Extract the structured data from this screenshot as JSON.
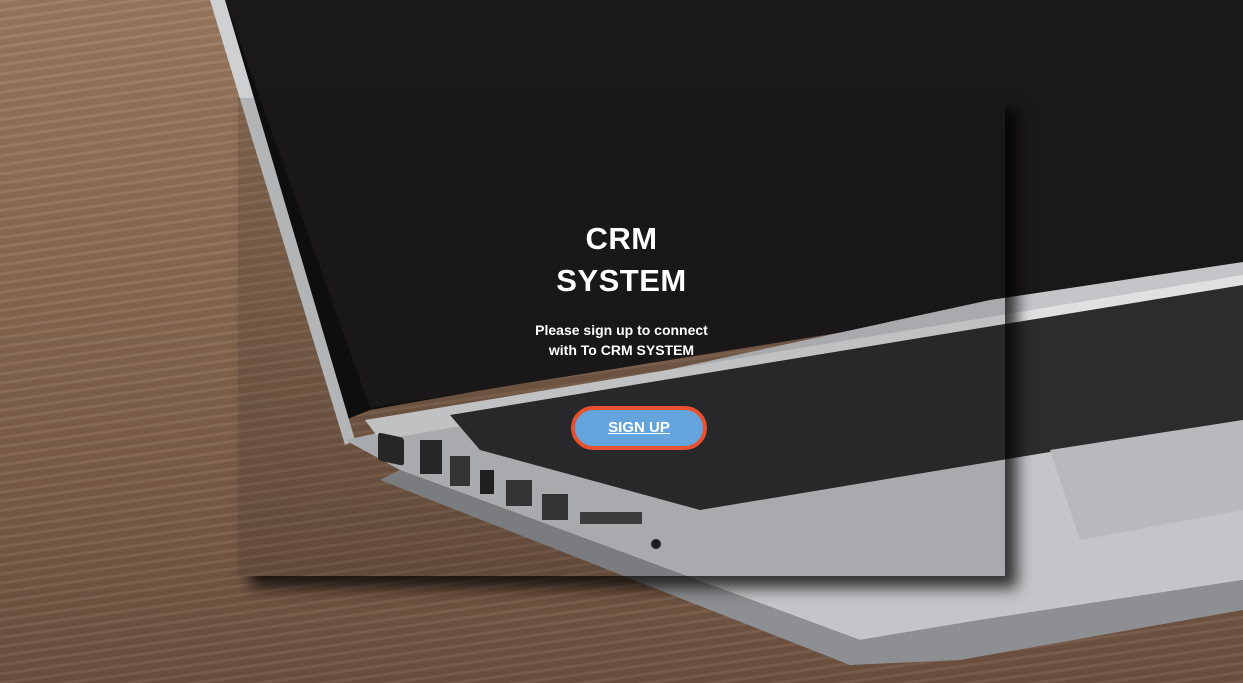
{
  "app": {
    "title_line1": "CRM",
    "title_line2": "SYSTEM",
    "subtitle_line1": "Please sign up to connect",
    "subtitle_line2": "with To CRM SYSTEM",
    "signup_label": "SIGN UP"
  },
  "colors": {
    "button_fill": "#64a4dd",
    "button_border": "#e8502f",
    "text": "#ffffff"
  }
}
